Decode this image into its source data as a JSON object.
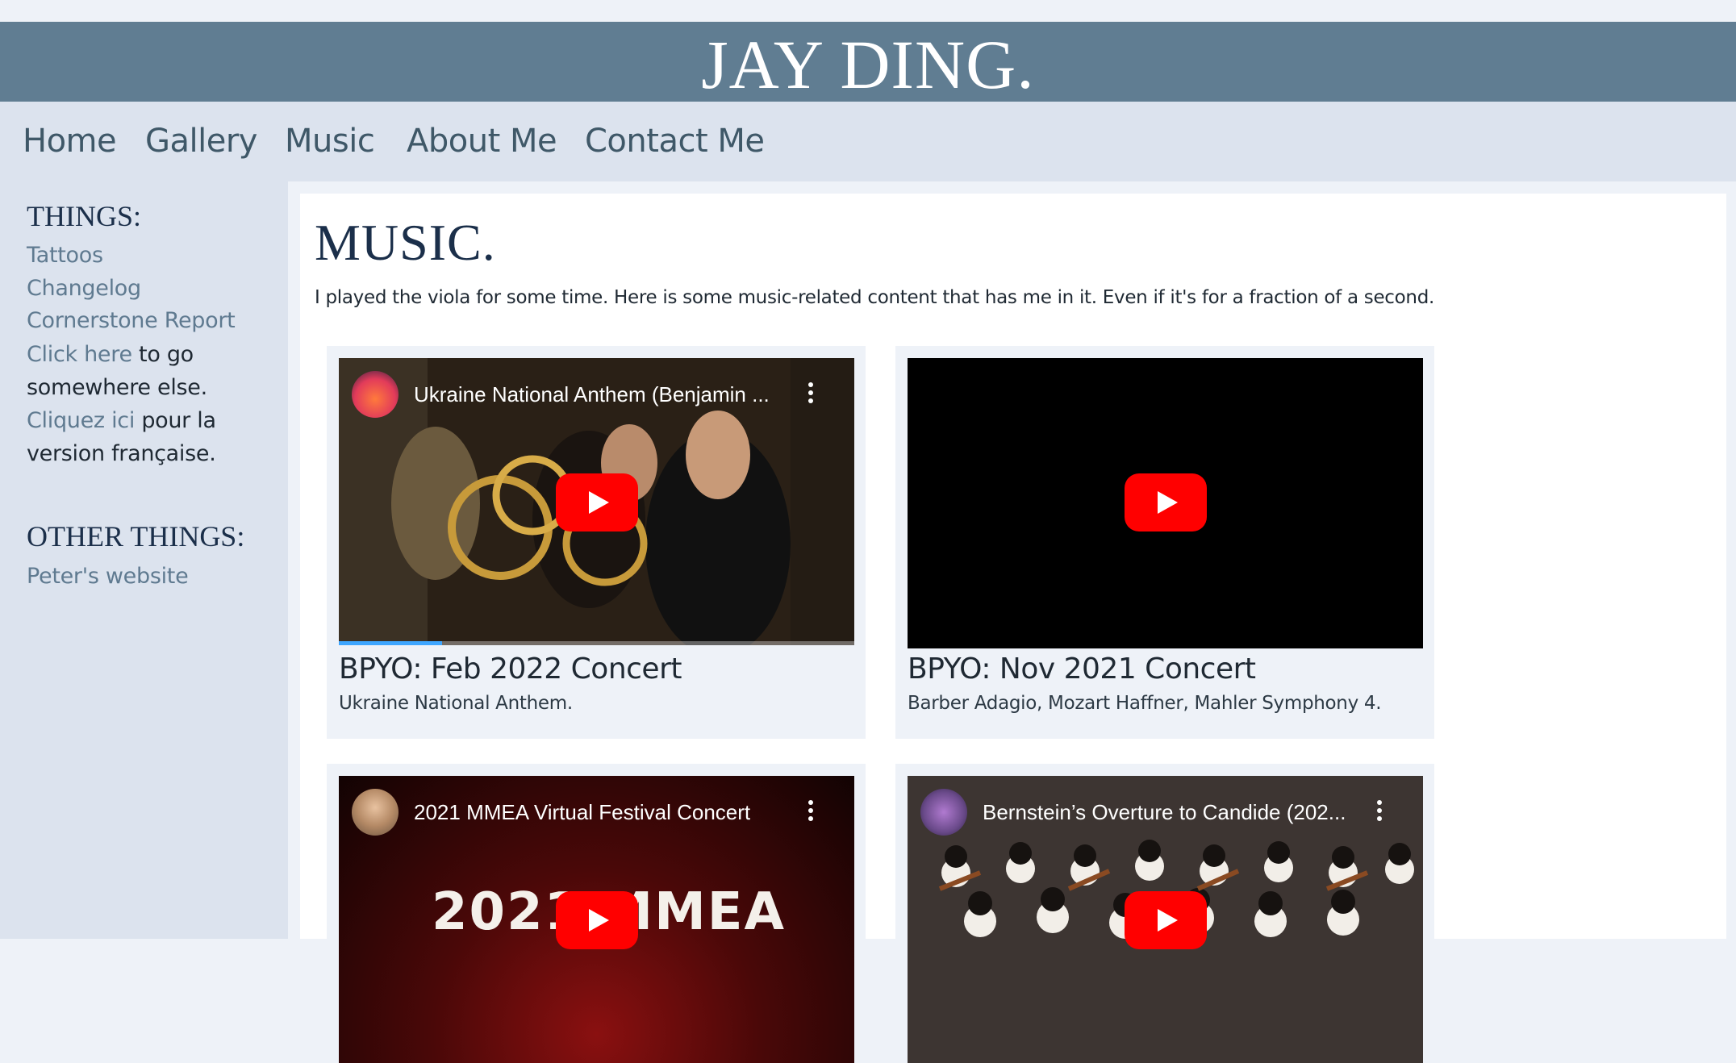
{
  "site": {
    "title": "JAY DING."
  },
  "nav": [
    {
      "label": "Home"
    },
    {
      "label": "Gallery"
    },
    {
      "label": "Music"
    },
    {
      "label": "About Me"
    },
    {
      "label": "Contact Me"
    }
  ],
  "sidebar": {
    "things_heading": "THINGS:",
    "links": [
      {
        "label": "Tattoos"
      },
      {
        "label": "Changelog"
      },
      {
        "label": "Cornerstone Report"
      }
    ],
    "click_here": {
      "link": "Click here",
      "rest1": " to go",
      "rest2": "somewhere else."
    },
    "cliquez": {
      "link": "Cliquez ici",
      "rest1": " pour la",
      "rest2": "version française."
    },
    "other_heading": "OTHER THINGS:",
    "other_links": [
      {
        "label": "Peter's website"
      }
    ]
  },
  "main": {
    "heading": "MUSIC.",
    "intro": "I played the viola for some time. Here is some music-related content that has me in it. Even if it's for a fraction of a second."
  },
  "cards": [
    {
      "video_title": "Ukraine National Anthem (Benjamin ...",
      "title": "BPYO: Feb 2022 Concert",
      "desc": "Ukraine National Anthem.",
      "progress": 0.2
    },
    {
      "video_title": "",
      "title": "BPYO: Nov 2021 Concert",
      "desc": "Barber Adagio, Mozart Haffner, Mahler Symphony 4."
    },
    {
      "video_title": "2021 MMEA Virtual Festival Concert",
      "thumb_text": "2021 MMEA"
    },
    {
      "video_title": "Bernstein’s Overture to Candide (202..."
    }
  ],
  "colors": {
    "banner": "#607d92",
    "nav_bg": "#dce3ee",
    "link": "#5f7a90",
    "heading": "#1b2f4a",
    "play_red": "#ff0000"
  },
  "icons": [
    "play-icon",
    "more-vert-icon",
    "channel-avatar-icon"
  ]
}
